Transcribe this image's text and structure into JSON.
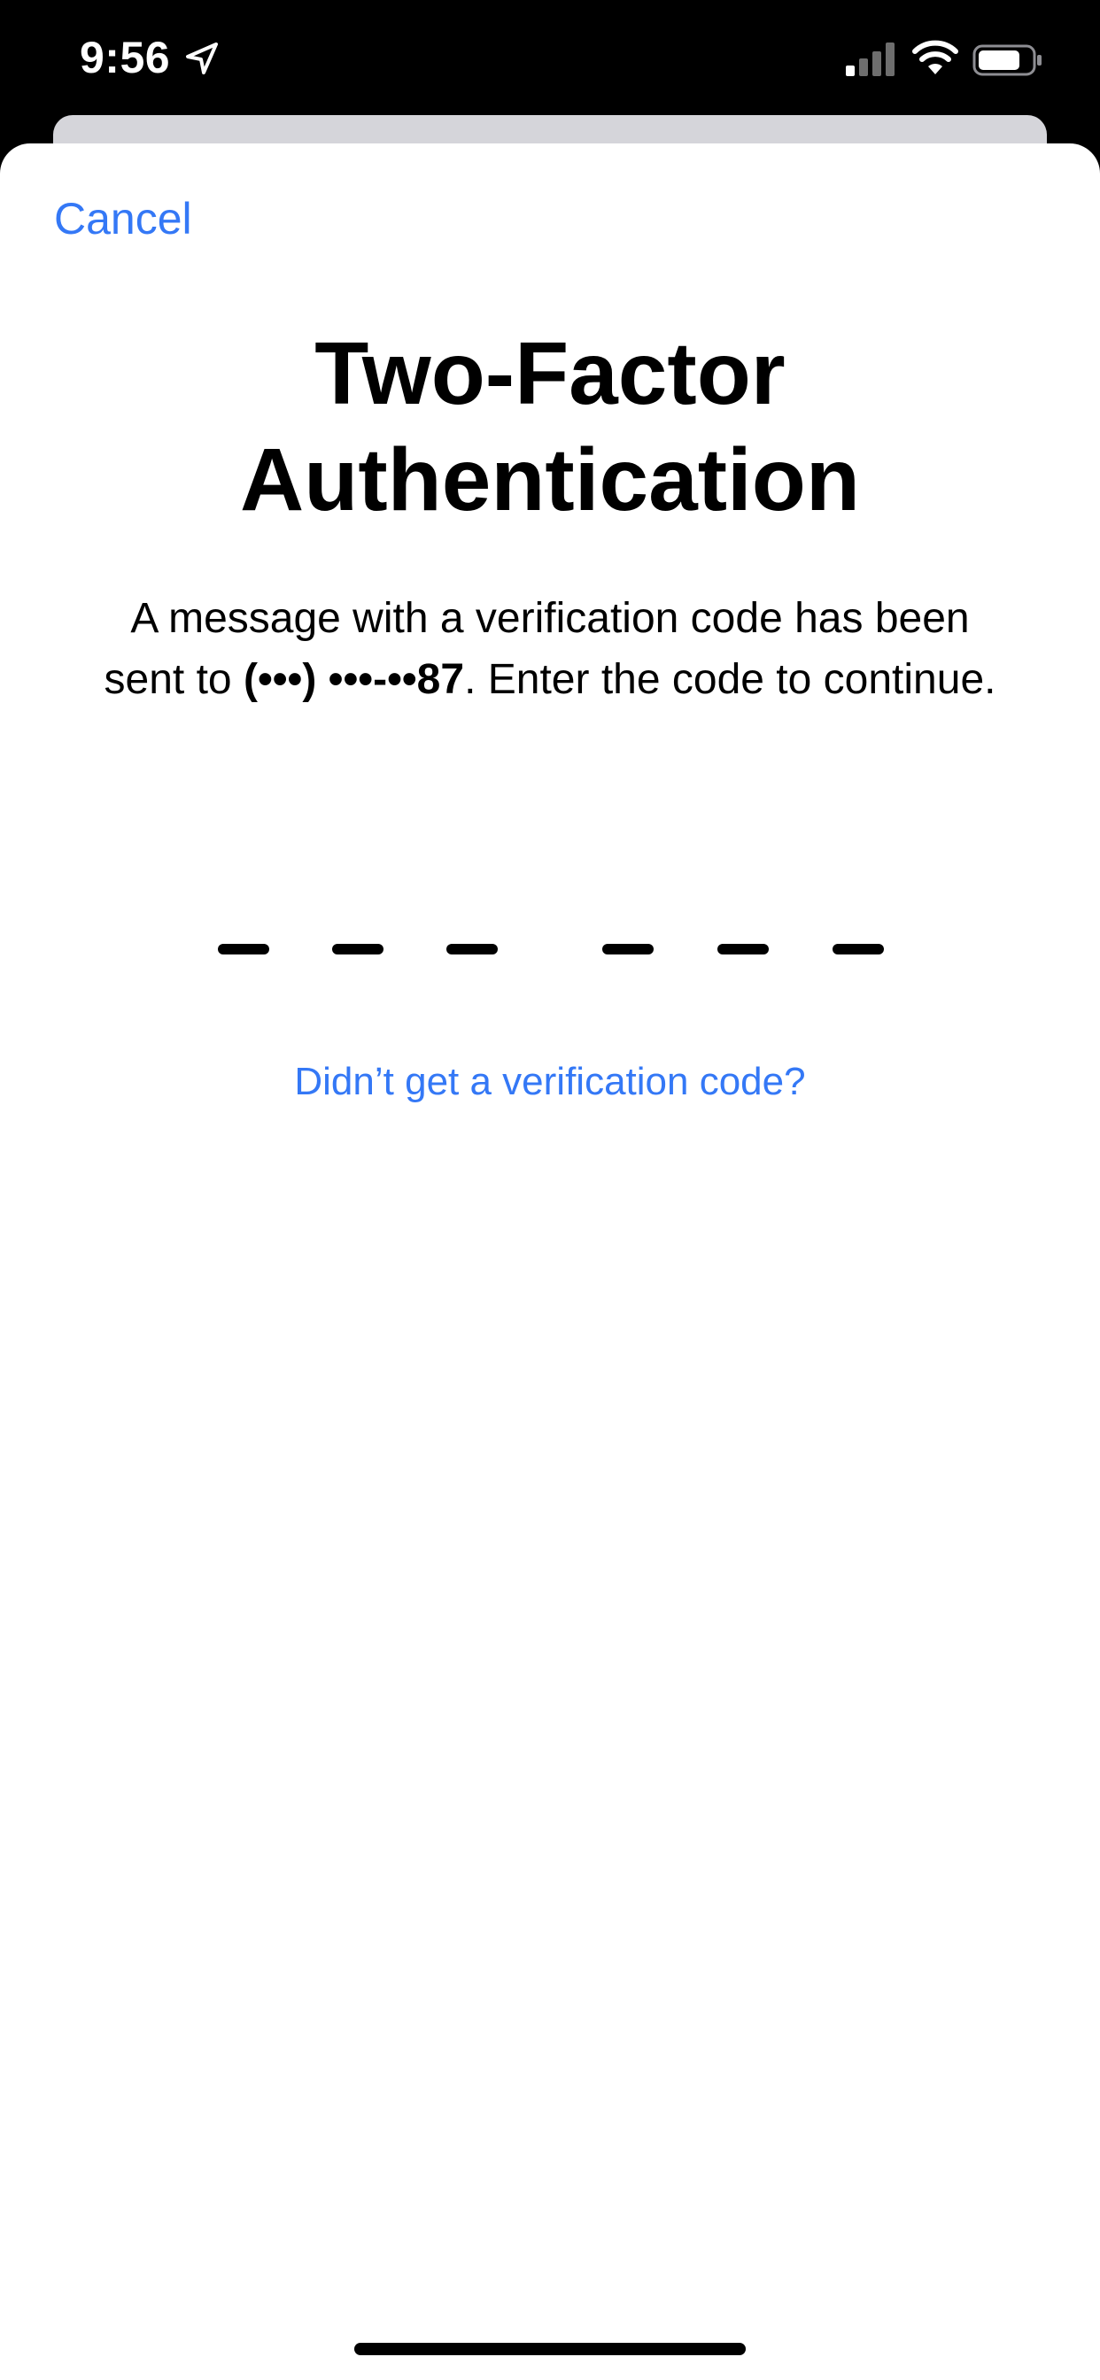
{
  "status_bar": {
    "time": "9:56",
    "icons": [
      "location-arrow-icon",
      "cellular-signal-icon",
      "wifi-icon",
      "battery-icon"
    ]
  },
  "sheet": {
    "cancel_label": "Cancel",
    "title_line1": "Two-Factor",
    "title_line2": "Authentication",
    "message_prefix": "A message with a verification code has been sent to ",
    "masked_phone": "(•••) •••-••87",
    "message_suffix": ". Enter the code to continue.",
    "code_slots": 6,
    "resend_label": "Didn’t get a verification code?"
  },
  "colors": {
    "accent": "#3478f6",
    "status_bar_bg": "#000000",
    "sheet_bg": "#ffffff",
    "back_card": "#d5d5da"
  }
}
